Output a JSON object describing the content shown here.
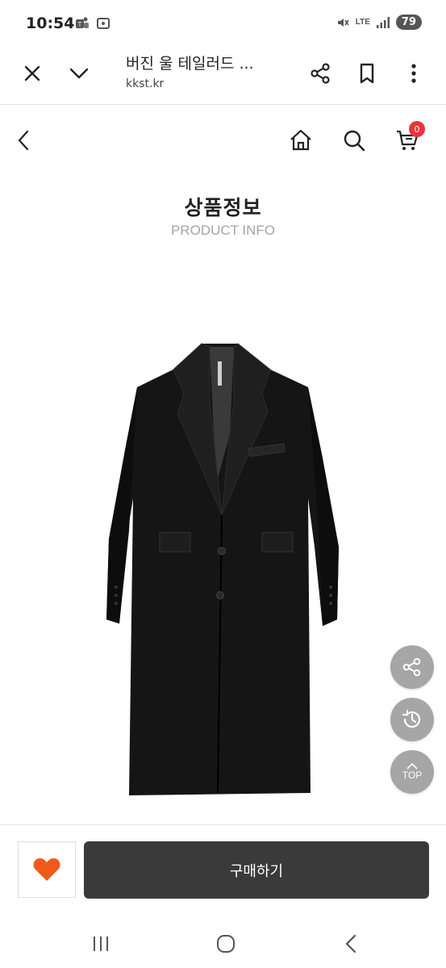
{
  "status_bar": {
    "time": "10:54",
    "network": "LTE",
    "battery": "79"
  },
  "browser": {
    "title": "버진 울 테일러드 ...",
    "url": "kkst.kr"
  },
  "site_header": {
    "cart_count": "0"
  },
  "page": {
    "title": "상품정보",
    "subtitle": "PRODUCT INFO"
  },
  "floating": {
    "top_label": "TOP"
  },
  "buy_bar": {
    "buy_label": "구매하기"
  },
  "colors": {
    "accent": "#f05a1a",
    "badge": "#e8343b",
    "buy_button": "#3a3a3a",
    "floating_button": "#a6a6a6"
  }
}
